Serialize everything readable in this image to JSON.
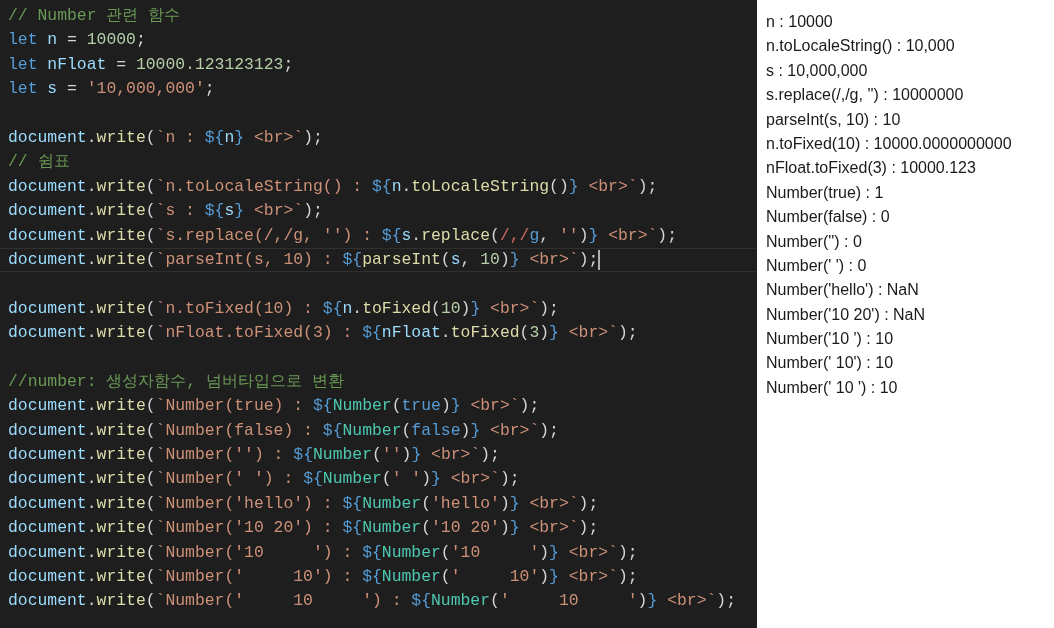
{
  "editor": {
    "blocks": [
      [
        {
          "tokens": [
            {
              "kind": "comment",
              "text": "// Number 관련 함수"
            }
          ]
        },
        {
          "tokens": [
            {
              "kind": "keyword",
              "text": "let "
            },
            {
              "kind": "variable",
              "text": "n"
            },
            {
              "kind": "punct",
              "text": " = "
            },
            {
              "kind": "number",
              "text": "10000"
            },
            {
              "kind": "punct",
              "text": ";"
            }
          ]
        },
        {
          "tokens": [
            {
              "kind": "keyword",
              "text": "let "
            },
            {
              "kind": "variable",
              "text": "nFloat"
            },
            {
              "kind": "punct",
              "text": " = "
            },
            {
              "kind": "number",
              "text": "10000.123123123"
            },
            {
              "kind": "punct",
              "text": ";"
            }
          ]
        },
        {
          "tokens": [
            {
              "kind": "keyword",
              "text": "let "
            },
            {
              "kind": "variable",
              "text": "s"
            },
            {
              "kind": "punct",
              "text": " = "
            },
            {
              "kind": "string",
              "text": "'10,000,000'"
            },
            {
              "kind": "punct",
              "text": ";"
            }
          ]
        }
      ],
      [
        {
          "tokens": [
            {
              "kind": "variable",
              "text": "document"
            },
            {
              "kind": "punct",
              "text": "."
            },
            {
              "kind": "function",
              "text": "write"
            },
            {
              "kind": "punct",
              "text": "("
            },
            {
              "kind": "string",
              "text": "`n : "
            },
            {
              "kind": "interp",
              "text": "${"
            },
            {
              "kind": "variable",
              "text": "n"
            },
            {
              "kind": "interp",
              "text": "}"
            },
            {
              "kind": "string",
              "text": " <br>`"
            },
            {
              "kind": "punct",
              "text": ");"
            }
          ]
        },
        {
          "tokens": [
            {
              "kind": "comment",
              "text": "// 쉼표"
            }
          ]
        },
        {
          "tokens": [
            {
              "kind": "variable",
              "text": "document"
            },
            {
              "kind": "punct",
              "text": "."
            },
            {
              "kind": "function",
              "text": "write"
            },
            {
              "kind": "punct",
              "text": "("
            },
            {
              "kind": "string",
              "text": "`n.toLocaleString() : "
            },
            {
              "kind": "interp",
              "text": "${"
            },
            {
              "kind": "variable",
              "text": "n"
            },
            {
              "kind": "punct",
              "text": "."
            },
            {
              "kind": "function",
              "text": "toLocaleString"
            },
            {
              "kind": "punct",
              "text": "()"
            },
            {
              "kind": "interp",
              "text": "}"
            },
            {
              "kind": "string",
              "text": " <br>`"
            },
            {
              "kind": "punct",
              "text": ");"
            }
          ]
        },
        {
          "tokens": [
            {
              "kind": "variable",
              "text": "document"
            },
            {
              "kind": "punct",
              "text": "."
            },
            {
              "kind": "function",
              "text": "write"
            },
            {
              "kind": "punct",
              "text": "("
            },
            {
              "kind": "string",
              "text": "`s : "
            },
            {
              "kind": "interp",
              "text": "${"
            },
            {
              "kind": "variable",
              "text": "s"
            },
            {
              "kind": "interp",
              "text": "}"
            },
            {
              "kind": "string",
              "text": " <br>`"
            },
            {
              "kind": "punct",
              "text": ");"
            }
          ]
        },
        {
          "tokens": [
            {
              "kind": "variable",
              "text": "document"
            },
            {
              "kind": "punct",
              "text": "."
            },
            {
              "kind": "function",
              "text": "write"
            },
            {
              "kind": "punct",
              "text": "("
            },
            {
              "kind": "string",
              "text": "`s.replace(/,/g, '') : "
            },
            {
              "kind": "interp",
              "text": "${"
            },
            {
              "kind": "variable",
              "text": "s"
            },
            {
              "kind": "punct",
              "text": "."
            },
            {
              "kind": "function",
              "text": "replace"
            },
            {
              "kind": "punct",
              "text": "("
            },
            {
              "kind": "regex",
              "text": "/,/"
            },
            {
              "kind": "keyword",
              "text": "g"
            },
            {
              "kind": "punct",
              "text": ", "
            },
            {
              "kind": "string",
              "text": "''"
            },
            {
              "kind": "punct",
              "text": ")"
            },
            {
              "kind": "interp",
              "text": "}"
            },
            {
              "kind": "string",
              "text": " <br>`"
            },
            {
              "kind": "punct",
              "text": ");"
            }
          ]
        },
        {
          "current": true,
          "tokens": [
            {
              "kind": "variable",
              "text": "document"
            },
            {
              "kind": "punct",
              "text": "."
            },
            {
              "kind": "function",
              "text": "write"
            },
            {
              "kind": "punct",
              "text": "("
            },
            {
              "kind": "string",
              "text": "`parseInt(s, 10) : "
            },
            {
              "kind": "interp",
              "text": "${"
            },
            {
              "kind": "function",
              "text": "parseInt"
            },
            {
              "kind": "punct",
              "text": "("
            },
            {
              "kind": "variable",
              "text": "s"
            },
            {
              "kind": "punct",
              "text": ", "
            },
            {
              "kind": "number",
              "text": "10"
            },
            {
              "kind": "punct",
              "text": ")"
            },
            {
              "kind": "interp",
              "text": "}"
            },
            {
              "kind": "string",
              "text": " <br>`"
            },
            {
              "kind": "punct",
              "text": ");"
            }
          ]
        }
      ],
      [
        {
          "tokens": [
            {
              "kind": "variable",
              "text": "document"
            },
            {
              "kind": "punct",
              "text": "."
            },
            {
              "kind": "function",
              "text": "write"
            },
            {
              "kind": "punct",
              "text": "("
            },
            {
              "kind": "string",
              "text": "`n.toFixed(10) : "
            },
            {
              "kind": "interp",
              "text": "${"
            },
            {
              "kind": "variable",
              "text": "n"
            },
            {
              "kind": "punct",
              "text": "."
            },
            {
              "kind": "function",
              "text": "toFixed"
            },
            {
              "kind": "punct",
              "text": "("
            },
            {
              "kind": "number",
              "text": "10"
            },
            {
              "kind": "punct",
              "text": ")"
            },
            {
              "kind": "interp",
              "text": "}"
            },
            {
              "kind": "string",
              "text": " <br>`"
            },
            {
              "kind": "punct",
              "text": ");"
            }
          ]
        },
        {
          "tokens": [
            {
              "kind": "variable",
              "text": "document"
            },
            {
              "kind": "punct",
              "text": "."
            },
            {
              "kind": "function",
              "text": "write"
            },
            {
              "kind": "punct",
              "text": "("
            },
            {
              "kind": "string",
              "text": "`nFloat.toFixed(3) : "
            },
            {
              "kind": "interp",
              "text": "${"
            },
            {
              "kind": "variable",
              "text": "nFloat"
            },
            {
              "kind": "punct",
              "text": "."
            },
            {
              "kind": "function",
              "text": "toFixed"
            },
            {
              "kind": "punct",
              "text": "("
            },
            {
              "kind": "number",
              "text": "3"
            },
            {
              "kind": "punct",
              "text": ")"
            },
            {
              "kind": "interp",
              "text": "}"
            },
            {
              "kind": "string",
              "text": " <br>`"
            },
            {
              "kind": "punct",
              "text": ");"
            }
          ]
        }
      ],
      [
        {
          "tokens": [
            {
              "kind": "comment",
              "text": "//number: 생성자함수, 넘버타입으로 변환"
            }
          ]
        },
        {
          "tokens": [
            {
              "kind": "variable",
              "text": "document"
            },
            {
              "kind": "punct",
              "text": "."
            },
            {
              "kind": "function",
              "text": "write"
            },
            {
              "kind": "punct",
              "text": "("
            },
            {
              "kind": "string",
              "text": "`Number(true) : "
            },
            {
              "kind": "interp",
              "text": "${"
            },
            {
              "kind": "class",
              "text": "Number"
            },
            {
              "kind": "punct",
              "text": "("
            },
            {
              "kind": "keyword",
              "text": "true"
            },
            {
              "kind": "punct",
              "text": ")"
            },
            {
              "kind": "interp",
              "text": "}"
            },
            {
              "kind": "string",
              "text": " <br>`"
            },
            {
              "kind": "punct",
              "text": ");"
            }
          ]
        },
        {
          "tokens": [
            {
              "kind": "variable",
              "text": "document"
            },
            {
              "kind": "punct",
              "text": "."
            },
            {
              "kind": "function",
              "text": "write"
            },
            {
              "kind": "punct",
              "text": "("
            },
            {
              "kind": "string",
              "text": "`Number(false) : "
            },
            {
              "kind": "interp",
              "text": "${"
            },
            {
              "kind": "class",
              "text": "Number"
            },
            {
              "kind": "punct",
              "text": "("
            },
            {
              "kind": "keyword",
              "text": "false"
            },
            {
              "kind": "punct",
              "text": ")"
            },
            {
              "kind": "interp",
              "text": "}"
            },
            {
              "kind": "string",
              "text": " <br>`"
            },
            {
              "kind": "punct",
              "text": ");"
            }
          ]
        },
        {
          "tokens": [
            {
              "kind": "variable",
              "text": "document"
            },
            {
              "kind": "punct",
              "text": "."
            },
            {
              "kind": "function",
              "text": "write"
            },
            {
              "kind": "punct",
              "text": "("
            },
            {
              "kind": "string",
              "text": "`Number('') : "
            },
            {
              "kind": "interp",
              "text": "${"
            },
            {
              "kind": "class",
              "text": "Number"
            },
            {
              "kind": "punct",
              "text": "("
            },
            {
              "kind": "string",
              "text": "''"
            },
            {
              "kind": "punct",
              "text": ")"
            },
            {
              "kind": "interp",
              "text": "}"
            },
            {
              "kind": "string",
              "text": " <br>`"
            },
            {
              "kind": "punct",
              "text": ");"
            }
          ]
        },
        {
          "tokens": [
            {
              "kind": "variable",
              "text": "document"
            },
            {
              "kind": "punct",
              "text": "."
            },
            {
              "kind": "function",
              "text": "write"
            },
            {
              "kind": "punct",
              "text": "("
            },
            {
              "kind": "string",
              "text": "`Number(' ') : "
            },
            {
              "kind": "interp",
              "text": "${"
            },
            {
              "kind": "class",
              "text": "Number"
            },
            {
              "kind": "punct",
              "text": "("
            },
            {
              "kind": "string",
              "text": "' '"
            },
            {
              "kind": "punct",
              "text": ")"
            },
            {
              "kind": "interp",
              "text": "}"
            },
            {
              "kind": "string",
              "text": " <br>`"
            },
            {
              "kind": "punct",
              "text": ");"
            }
          ]
        },
        {
          "tokens": [
            {
              "kind": "variable",
              "text": "document"
            },
            {
              "kind": "punct",
              "text": "."
            },
            {
              "kind": "function",
              "text": "write"
            },
            {
              "kind": "punct",
              "text": "("
            },
            {
              "kind": "string",
              "text": "`Number('hello') : "
            },
            {
              "kind": "interp",
              "text": "${"
            },
            {
              "kind": "class",
              "text": "Number"
            },
            {
              "kind": "punct",
              "text": "("
            },
            {
              "kind": "string",
              "text": "'hello'"
            },
            {
              "kind": "punct",
              "text": ")"
            },
            {
              "kind": "interp",
              "text": "}"
            },
            {
              "kind": "string",
              "text": " <br>`"
            },
            {
              "kind": "punct",
              "text": ");"
            }
          ]
        },
        {
          "tokens": [
            {
              "kind": "variable",
              "text": "document"
            },
            {
              "kind": "punct",
              "text": "."
            },
            {
              "kind": "function",
              "text": "write"
            },
            {
              "kind": "punct",
              "text": "("
            },
            {
              "kind": "string",
              "text": "`Number('10 20') : "
            },
            {
              "kind": "interp",
              "text": "${"
            },
            {
              "kind": "class",
              "text": "Number"
            },
            {
              "kind": "punct",
              "text": "("
            },
            {
              "kind": "string",
              "text": "'10 20'"
            },
            {
              "kind": "punct",
              "text": ")"
            },
            {
              "kind": "interp",
              "text": "}"
            },
            {
              "kind": "string",
              "text": " <br>`"
            },
            {
              "kind": "punct",
              "text": ");"
            }
          ]
        },
        {
          "tokens": [
            {
              "kind": "variable",
              "text": "document"
            },
            {
              "kind": "punct",
              "text": "."
            },
            {
              "kind": "function",
              "text": "write"
            },
            {
              "kind": "punct",
              "text": "("
            },
            {
              "kind": "string",
              "text": "`Number('10     ') : "
            },
            {
              "kind": "interp",
              "text": "${"
            },
            {
              "kind": "class",
              "text": "Number"
            },
            {
              "kind": "punct",
              "text": "("
            },
            {
              "kind": "string",
              "text": "'10     '"
            },
            {
              "kind": "punct",
              "text": ")"
            },
            {
              "kind": "interp",
              "text": "}"
            },
            {
              "kind": "string",
              "text": " <br>`"
            },
            {
              "kind": "punct",
              "text": ");"
            }
          ]
        },
        {
          "tokens": [
            {
              "kind": "variable",
              "text": "document"
            },
            {
              "kind": "punct",
              "text": "."
            },
            {
              "kind": "function",
              "text": "write"
            },
            {
              "kind": "punct",
              "text": "("
            },
            {
              "kind": "string",
              "text": "`Number('     10') : "
            },
            {
              "kind": "interp",
              "text": "${"
            },
            {
              "kind": "class",
              "text": "Number"
            },
            {
              "kind": "punct",
              "text": "("
            },
            {
              "kind": "string",
              "text": "'     10'"
            },
            {
              "kind": "punct",
              "text": ")"
            },
            {
              "kind": "interp",
              "text": "}"
            },
            {
              "kind": "string",
              "text": " <br>`"
            },
            {
              "kind": "punct",
              "text": ");"
            }
          ]
        },
        {
          "tokens": [
            {
              "kind": "variable",
              "text": "document"
            },
            {
              "kind": "punct",
              "text": "."
            },
            {
              "kind": "function",
              "text": "write"
            },
            {
              "kind": "punct",
              "text": "("
            },
            {
              "kind": "string",
              "text": "`Number('     10     ') : "
            },
            {
              "kind": "interp",
              "text": "${"
            },
            {
              "kind": "class",
              "text": "Number"
            },
            {
              "kind": "punct",
              "text": "("
            },
            {
              "kind": "string",
              "text": "'     10     '"
            },
            {
              "kind": "punct",
              "text": ")"
            },
            {
              "kind": "interp",
              "text": "}"
            },
            {
              "kind": "string",
              "text": " <br>`"
            },
            {
              "kind": "punct",
              "text": ");"
            }
          ]
        }
      ]
    ]
  },
  "output": {
    "lines": [
      "n : 10000",
      "n.toLocaleString() : 10,000",
      "s : 10,000,000",
      "s.replace(/,/g, '') : 10000000",
      "parseInt(s, 10) : 10",
      "n.toFixed(10) : 10000.0000000000",
      "nFloat.toFixed(3) : 10000.123",
      "Number(true) : 1",
      "Number(false) : 0",
      "Number('') : 0",
      "Number(' ') : 0",
      "Number('hello') : NaN",
      "Number('10 20') : NaN",
      "Number('10 ') : 10",
      "Number(' 10') : 10",
      "Number(' 10 ') : 10"
    ]
  }
}
